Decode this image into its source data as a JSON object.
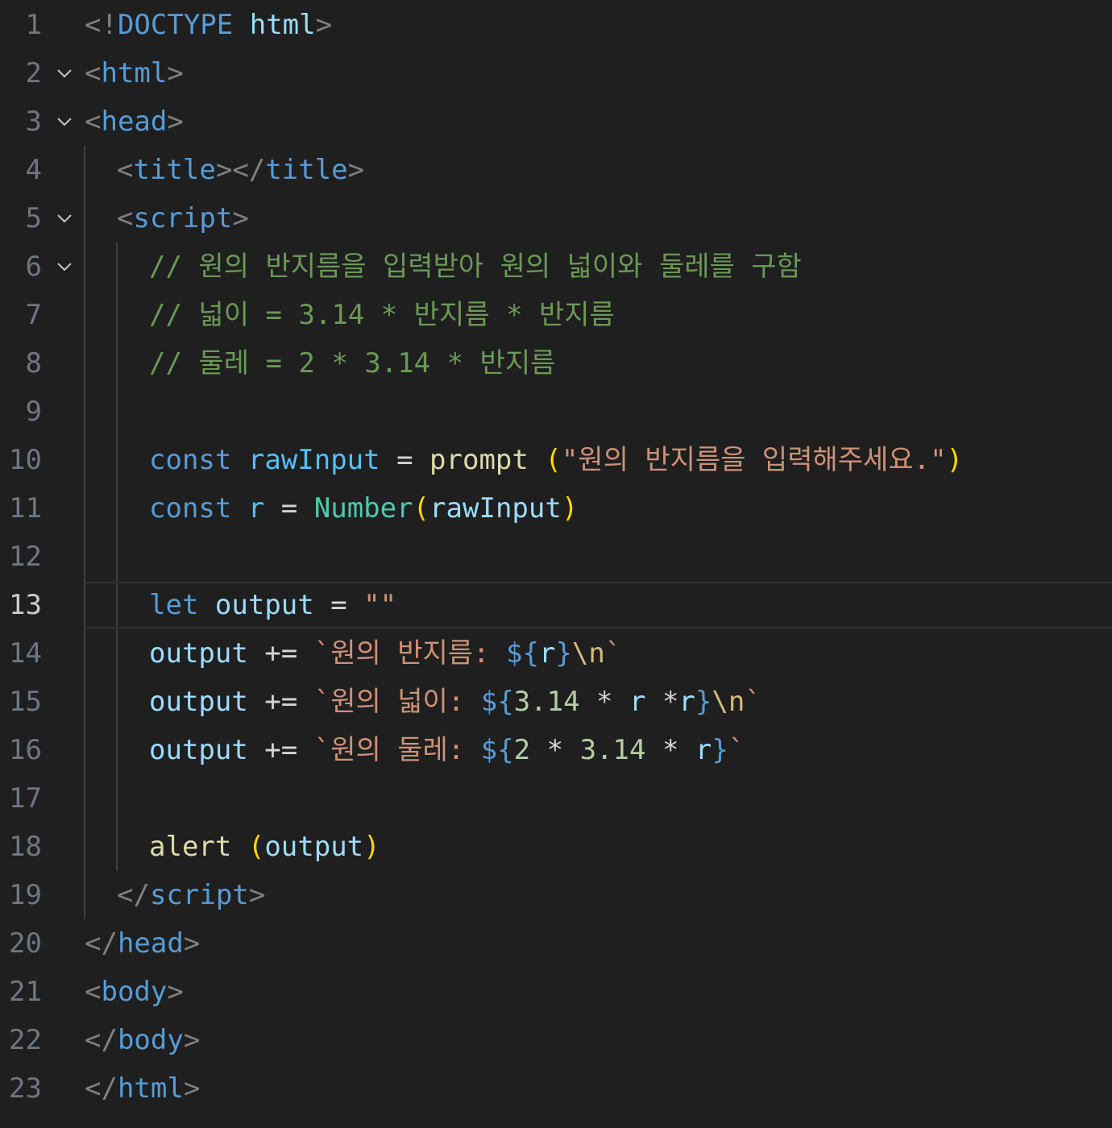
{
  "editor": {
    "current_line": 13,
    "lines": [
      {
        "n": "1",
        "fold": false,
        "indent": 0,
        "tokens": [
          [
            "punct",
            "<!"
          ],
          [
            "tag",
            "DOCTYPE"
          ],
          [
            "plain",
            " "
          ],
          [
            "attr",
            "html"
          ],
          [
            "punct",
            ">"
          ]
        ]
      },
      {
        "n": "2",
        "fold": true,
        "indent": 0,
        "tokens": [
          [
            "punct",
            "<"
          ],
          [
            "tag",
            "html"
          ],
          [
            "punct",
            ">"
          ]
        ]
      },
      {
        "n": "3",
        "fold": true,
        "indent": 0,
        "tokens": [
          [
            "punct",
            "<"
          ],
          [
            "tag",
            "head"
          ],
          [
            "punct",
            ">"
          ]
        ]
      },
      {
        "n": "4",
        "fold": false,
        "indent": 1,
        "tokens": [
          [
            "punct",
            "<"
          ],
          [
            "tag",
            "title"
          ],
          [
            "punct",
            "></"
          ],
          [
            "tag",
            "title"
          ],
          [
            "punct",
            ">"
          ]
        ]
      },
      {
        "n": "5",
        "fold": true,
        "indent": 1,
        "tokens": [
          [
            "punct",
            "<"
          ],
          [
            "tag",
            "script"
          ],
          [
            "punct",
            ">"
          ]
        ]
      },
      {
        "n": "6",
        "fold": true,
        "indent": 2,
        "tokens": [
          [
            "cmt",
            "// 원의 반지름을 입력받아 원의 넓이와 둘레를 구함"
          ]
        ]
      },
      {
        "n": "7",
        "fold": false,
        "indent": 2,
        "tokens": [
          [
            "cmt",
            "// 넓이 = 3.14 * 반지름 * 반지름"
          ]
        ]
      },
      {
        "n": "8",
        "fold": false,
        "indent": 2,
        "tokens": [
          [
            "cmt",
            "// 둘레 = 2 * 3.14 * 반지름"
          ]
        ]
      },
      {
        "n": "9",
        "fold": false,
        "indent": 2,
        "tokens": []
      },
      {
        "n": "10",
        "fold": false,
        "indent": 2,
        "tokens": [
          [
            "kw",
            "const"
          ],
          [
            "plain",
            " "
          ],
          [
            "cst",
            "rawInput"
          ],
          [
            "op",
            " = "
          ],
          [
            "fn",
            "prompt"
          ],
          [
            "plain",
            " "
          ],
          [
            "br1",
            "("
          ],
          [
            "str",
            "\"원의 반지름을 입력해주세요.\""
          ],
          [
            "br1",
            ")"
          ]
        ]
      },
      {
        "n": "11",
        "fold": false,
        "indent": 2,
        "tokens": [
          [
            "kw",
            "const"
          ],
          [
            "plain",
            " "
          ],
          [
            "cst",
            "r"
          ],
          [
            "op",
            " = "
          ],
          [
            "cls",
            "Number"
          ],
          [
            "br1",
            "("
          ],
          [
            "var",
            "rawInput"
          ],
          [
            "br1",
            ")"
          ]
        ]
      },
      {
        "n": "12",
        "fold": false,
        "indent": 2,
        "tokens": []
      },
      {
        "n": "13",
        "fold": false,
        "indent": 2,
        "tokens": [
          [
            "kw",
            "let"
          ],
          [
            "plain",
            " "
          ],
          [
            "var",
            "output"
          ],
          [
            "op",
            " = "
          ],
          [
            "str",
            "\"\""
          ]
        ]
      },
      {
        "n": "14",
        "fold": false,
        "indent": 2,
        "tokens": [
          [
            "var",
            "output"
          ],
          [
            "op",
            " += "
          ],
          [
            "str",
            "`원의 반지름: "
          ],
          [
            "kw",
            "${"
          ],
          [
            "var",
            "r"
          ],
          [
            "kw",
            "}"
          ],
          [
            "esc",
            "\\n"
          ],
          [
            "str",
            "`"
          ]
        ]
      },
      {
        "n": "15",
        "fold": false,
        "indent": 2,
        "tokens": [
          [
            "var",
            "output"
          ],
          [
            "op",
            " += "
          ],
          [
            "str",
            "`원의 넓이: "
          ],
          [
            "kw",
            "${"
          ],
          [
            "num",
            "3.14"
          ],
          [
            "op",
            " * "
          ],
          [
            "var",
            "r"
          ],
          [
            "op",
            " *"
          ],
          [
            "var",
            "r"
          ],
          [
            "kw",
            "}"
          ],
          [
            "esc",
            "\\n"
          ],
          [
            "str",
            "`"
          ]
        ]
      },
      {
        "n": "16",
        "fold": false,
        "indent": 2,
        "tokens": [
          [
            "var",
            "output"
          ],
          [
            "op",
            " += "
          ],
          [
            "str",
            "`원의 둘레: "
          ],
          [
            "kw",
            "${"
          ],
          [
            "num",
            "2"
          ],
          [
            "op",
            " * "
          ],
          [
            "num",
            "3.14"
          ],
          [
            "op",
            " * "
          ],
          [
            "var",
            "r"
          ],
          [
            "kw",
            "}"
          ],
          [
            "str",
            "`"
          ]
        ]
      },
      {
        "n": "17",
        "fold": false,
        "indent": 2,
        "tokens": []
      },
      {
        "n": "18",
        "fold": false,
        "indent": 2,
        "tokens": [
          [
            "fn",
            "alert"
          ],
          [
            "plain",
            " "
          ],
          [
            "br1",
            "("
          ],
          [
            "var",
            "output"
          ],
          [
            "br1",
            ")"
          ]
        ]
      },
      {
        "n": "19",
        "fold": false,
        "indent": 1,
        "tokens": [
          [
            "punct",
            "</"
          ],
          [
            "tag",
            "script"
          ],
          [
            "punct",
            ">"
          ]
        ]
      },
      {
        "n": "20",
        "fold": false,
        "indent": 0,
        "tokens": [
          [
            "punct",
            "</"
          ],
          [
            "tag",
            "head"
          ],
          [
            "punct",
            ">"
          ]
        ]
      },
      {
        "n": "21",
        "fold": false,
        "indent": 0,
        "tokens": [
          [
            "punct",
            "<"
          ],
          [
            "tag",
            "body"
          ],
          [
            "punct",
            ">"
          ]
        ]
      },
      {
        "n": "22",
        "fold": false,
        "indent": 0,
        "tokens": [
          [
            "punct",
            "</"
          ],
          [
            "tag",
            "body"
          ],
          [
            "punct",
            ">"
          ]
        ]
      },
      {
        "n": "23",
        "fold": false,
        "indent": 0,
        "tokens": [
          [
            "punct",
            "</"
          ],
          [
            "tag",
            "html"
          ],
          [
            "punct",
            ">"
          ]
        ]
      }
    ]
  },
  "colors": {
    "background": "#1f1f1f",
    "line_number": "#6e7681",
    "line_number_active": "#cccccc",
    "punct": "#808080",
    "tag": "#569cd6",
    "keyword": "#569cd6",
    "variable": "#9cdcfe",
    "function": "#dcdcaa",
    "class": "#4ec9b0",
    "string": "#ce9178",
    "number": "#b5cea8",
    "comment": "#6a9955",
    "bracket": "#ffd700"
  },
  "icons": {
    "fold": "chevron-down-icon"
  }
}
